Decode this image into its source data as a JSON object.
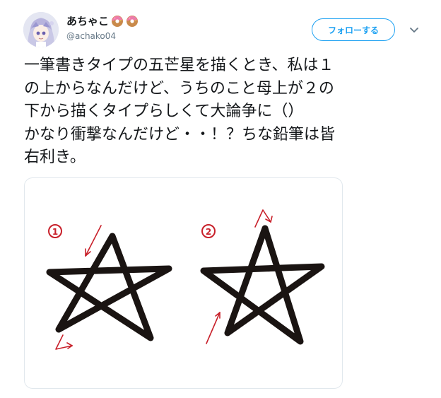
{
  "user": {
    "display_name": "あちゃこ",
    "handle": "@achako04",
    "emoji_icons": [
      "donut-icon",
      "donut-icon"
    ]
  },
  "actions": {
    "follow_label": "フォローする",
    "menu_icon": "chevron-down-icon"
  },
  "tweet": {
    "text": "一筆書きタイプの五芒星を描くとき、私は１\nの上からなんだけど、うちのこと母上が２の\n下から描くタイプらしくて大論争に（）\nかなり衝撃なんだけど・・！？ちな鉛筆は皆\n右利き。"
  },
  "media": {
    "label_1": "①",
    "label_2": "②",
    "arrow_color": "#c8202a",
    "star_color": "#1a1412"
  },
  "colors": {
    "accent": "#1da1f2",
    "text": "#14171a",
    "secondary": "#657786",
    "border": "#e1e8ed"
  }
}
